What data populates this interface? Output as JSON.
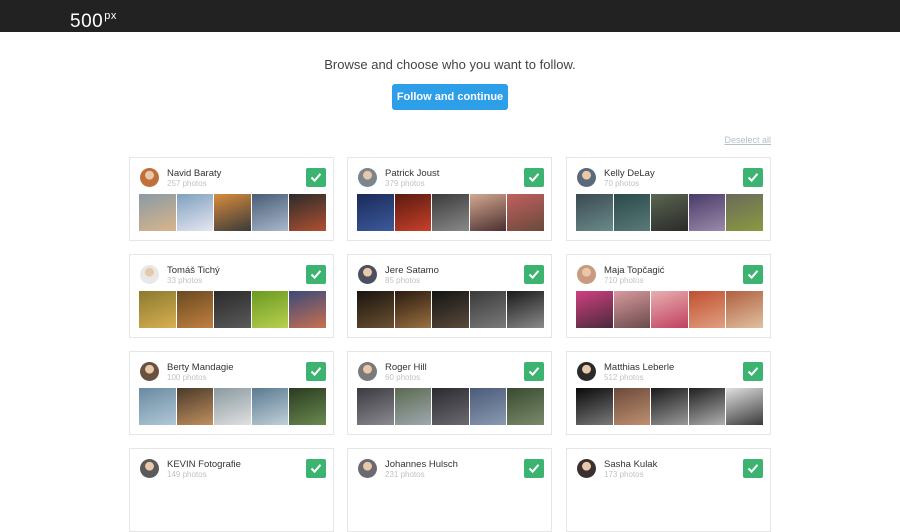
{
  "brand": {
    "logo_text": "500",
    "logo_sup": "px"
  },
  "intro": {
    "prompt": "Browse and choose who you want to follow.",
    "follow_button": "Follow and continue",
    "deselect_all": "Deselect all"
  },
  "colors": {
    "topbar": "#222222",
    "accent": "#2d9ee8",
    "check": "#3cb371"
  },
  "users": [
    {
      "name": "Navid Baraty",
      "photos": "257 photos",
      "selected": true,
      "avatar_color": "#c0703a",
      "thumbs": [
        [
          "#8a9aa6",
          "#d9b58a"
        ],
        [
          "#7fa0bf",
          "#e6e6f0"
        ],
        [
          "#d98c3c",
          "#3a3a3a"
        ],
        [
          "#4a5d75",
          "#a8b8cc"
        ],
        [
          "#2b2b2b",
          "#b05030"
        ]
      ]
    },
    {
      "name": "Patrick Joust",
      "photos": "379 photos",
      "selected": true,
      "avatar_color": "#7a8590",
      "thumbs": [
        [
          "#1a2a5a",
          "#3c5a9a"
        ],
        [
          "#5a1a10",
          "#c8402a"
        ],
        [
          "#3a3a3a",
          "#8a8a8a"
        ],
        [
          "#d4a890",
          "#4a3030"
        ],
        [
          "#c06060",
          "#6a4a3a"
        ]
      ]
    },
    {
      "name": "Kelly DeLay",
      "photos": "70 photos",
      "selected": true,
      "avatar_color": "#5a6a7a",
      "thumbs": [
        [
          "#3a4a50",
          "#6a8a8a"
        ],
        [
          "#2a4a4a",
          "#5a7a7a"
        ],
        [
          "#5a6650",
          "#2a2a2a"
        ],
        [
          "#4a3a6a",
          "#9a8aaa"
        ],
        [
          "#6a6a5a",
          "#8a9a40"
        ]
      ]
    },
    {
      "name": "Tomáš Tichý",
      "photos": "33 photos",
      "selected": true,
      "avatar_color": "#e8e8e8",
      "thumbs": [
        [
          "#8a7a30",
          "#d8b050"
        ],
        [
          "#6a4a20",
          "#c08040"
        ],
        [
          "#2a2a2a",
          "#5a5a5a"
        ],
        [
          "#6a9a20",
          "#b8d050"
        ],
        [
          "#3a4a7a",
          "#c87050"
        ]
      ]
    },
    {
      "name": "Jere Satamo",
      "photos": "85 photos",
      "selected": true,
      "avatar_color": "#4a5060",
      "thumbs": [
        [
          "#1a1410",
          "#6a5030"
        ],
        [
          "#2a1a10",
          "#9a7040"
        ],
        [
          "#141414",
          "#5a4a3a"
        ],
        [
          "#3a3a3a",
          "#7a7a7a"
        ],
        [
          "#1a1a1a",
          "#8a8a8a"
        ]
      ]
    },
    {
      "name": "Maja Topčagić",
      "photos": "710 photos",
      "selected": true,
      "avatar_color": "#c89a80",
      "thumbs": [
        [
          "#d04080",
          "#4a2a3a"
        ],
        [
          "#d89aa0",
          "#6a4a4a"
        ],
        [
          "#e8b0b0",
          "#c04060"
        ],
        [
          "#c05030",
          "#e0a080"
        ],
        [
          "#b06040",
          "#e0c0a0"
        ]
      ]
    },
    {
      "name": "Berty Mandagie",
      "photos": "100 photos",
      "selected": true,
      "avatar_color": "#6a5040",
      "thumbs": [
        [
          "#6a8aa0",
          "#b0c8d8"
        ],
        [
          "#4a3a2a",
          "#c09060"
        ],
        [
          "#8a9aa0",
          "#e0e0e0"
        ],
        [
          "#5a7a90",
          "#c0d0d8"
        ],
        [
          "#2a3a20",
          "#6a8a50"
        ]
      ]
    },
    {
      "name": "Roger Hill",
      "photos": "60 photos",
      "selected": true,
      "avatar_color": "#7a7a7a",
      "thumbs": [
        [
          "#3a3a40",
          "#8a8a90"
        ],
        [
          "#5a6a50",
          "#a0a8b0"
        ],
        [
          "#2a2a30",
          "#6a6a70"
        ],
        [
          "#4a5a7a",
          "#8a9ab0"
        ],
        [
          "#3a4a30",
          "#7a8a6a"
        ]
      ]
    },
    {
      "name": "Matthias Leberle",
      "photos": "512 photos",
      "selected": true,
      "avatar_color": "#2a2a2a",
      "thumbs": [
        [
          "#0a0a0a",
          "#7a7a7a"
        ],
        [
          "#6a4a3a",
          "#c09070"
        ],
        [
          "#1a1a1a",
          "#9a9a9a"
        ],
        [
          "#202020",
          "#b0b0b0"
        ],
        [
          "#e0e0e0",
          "#3a3a3a"
        ]
      ]
    },
    {
      "name": "KEVIN Fotografie",
      "photos": "149 photos",
      "selected": true,
      "avatar_color": "#5a5a5a",
      "thumbs": []
    },
    {
      "name": "Johannes Hulsch",
      "photos": "231 photos",
      "selected": true,
      "avatar_color": "#6a6a70",
      "thumbs": []
    },
    {
      "name": "Sasha Kulak",
      "photos": "173 photos",
      "selected": true,
      "avatar_color": "#3a3030",
      "thumbs": []
    }
  ]
}
